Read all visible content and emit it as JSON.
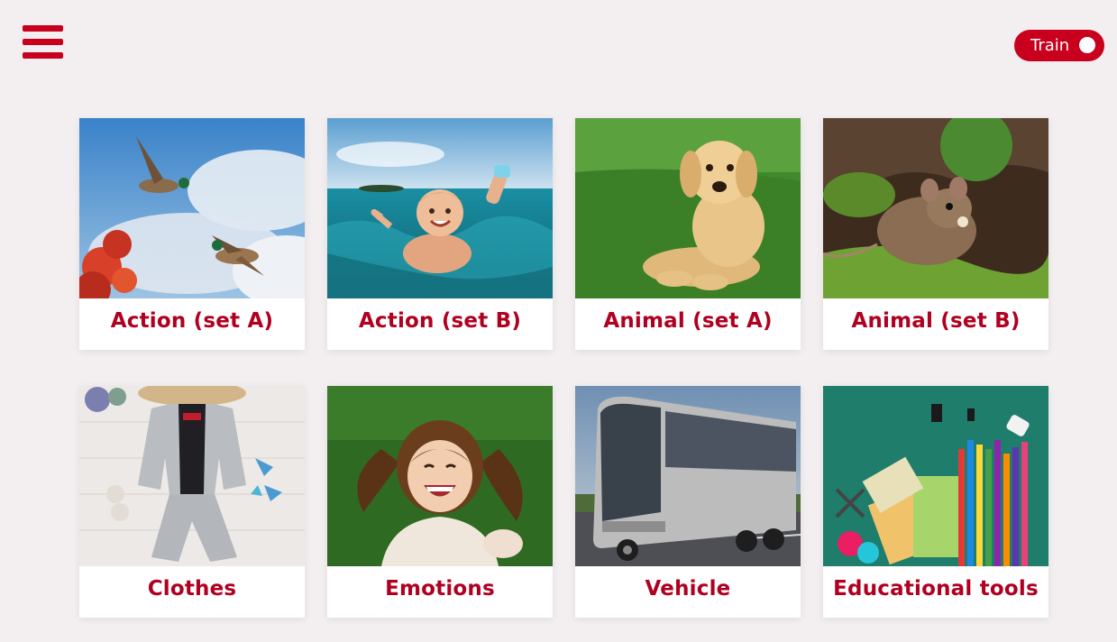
{
  "header": {
    "menu_icon": "hamburger-menu-icon",
    "train_toggle": {
      "label": "Train",
      "on": true
    }
  },
  "colors": {
    "accent": "#c8001e",
    "label": "#b00020",
    "background": "#f3eff1"
  },
  "categories": [
    {
      "label": "Action (set A)",
      "image": "flying-ducks"
    },
    {
      "label": "Action (set B)",
      "image": "child-swimming"
    },
    {
      "label": "Animal (set A)",
      "image": "golden-puppy"
    },
    {
      "label": "Animal (set B)",
      "image": "mouse"
    },
    {
      "label": "Clothes",
      "image": "kids-suit-outfit"
    },
    {
      "label": "Emotions",
      "image": "laughing-girl"
    },
    {
      "label": "Vehicle",
      "image": "coach-bus"
    },
    {
      "label": "Educational tools",
      "image": "school-supplies"
    }
  ]
}
